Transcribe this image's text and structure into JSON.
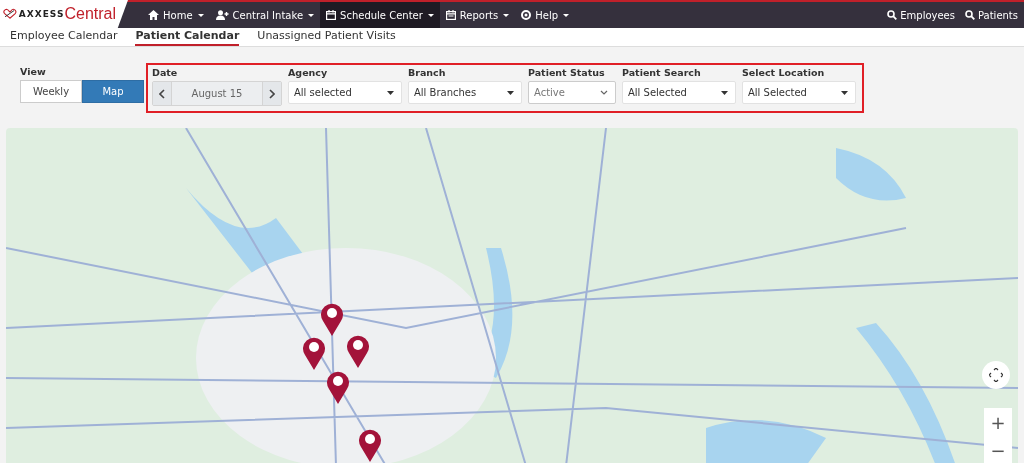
{
  "logo": {
    "brand": "AXXESS",
    "product": "Central"
  },
  "nav": {
    "items": [
      {
        "label": "Home",
        "kind": "home",
        "selected": false
      },
      {
        "label": "Central Intake",
        "kind": "intake",
        "selected": false
      },
      {
        "label": "Schedule Center",
        "kind": "schedule",
        "selected": true
      },
      {
        "label": "Reports",
        "kind": "reports",
        "selected": false
      },
      {
        "label": "Help",
        "kind": "help",
        "selected": false
      }
    ],
    "search_links": [
      "Employees",
      "Patients"
    ]
  },
  "tabs": [
    {
      "label": "Employee Calendar",
      "selected": false
    },
    {
      "label": "Patient Calendar",
      "selected": true
    },
    {
      "label": "Unassigned Patient Visits",
      "selected": false
    }
  ],
  "view": {
    "label": "View",
    "options": [
      {
        "label": "Weekly",
        "selected": false
      },
      {
        "label": "Map",
        "selected": true
      }
    ]
  },
  "filters": {
    "highlighted": true,
    "date": {
      "label": "Date",
      "value": "August 15"
    },
    "dropdowns": [
      {
        "label": "Agency",
        "value": "All selected",
        "kind": "multi"
      },
      {
        "label": "Branch",
        "value": "All Branches",
        "kind": "multi"
      },
      {
        "label": "Patient Status",
        "value": "Active",
        "kind": "select"
      },
      {
        "label": "Patient Search",
        "value": "All Selected",
        "kind": "multi"
      },
      {
        "label": "Select Location",
        "value": "All Selected",
        "kind": "multi"
      }
    ]
  },
  "map": {
    "zoom_in": "+",
    "zoom_out": "−"
  }
}
